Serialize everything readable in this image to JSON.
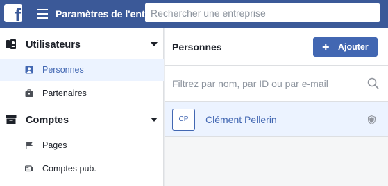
{
  "topbar": {
    "logo_letter": "f",
    "app_title": "Paramètres de l'entreprise",
    "search_placeholder": "Rechercher une entreprise"
  },
  "sidebar": {
    "sections": [
      {
        "label": "Utilisateurs",
        "icon": "users-icon",
        "items": [
          {
            "label": "Personnes",
            "icon": "person-icon",
            "active": true
          },
          {
            "label": "Partenaires",
            "icon": "briefcase-icon",
            "active": false
          }
        ]
      },
      {
        "label": "Comptes",
        "icon": "archive-icon",
        "items": [
          {
            "label": "Pages",
            "icon": "flag-icon",
            "active": false
          },
          {
            "label": "Comptes pub.",
            "icon": "ad-account-icon",
            "active": false
          }
        ]
      }
    ]
  },
  "main": {
    "title": "Personnes",
    "add_button": "Ajouter",
    "filter_placeholder": "Filtrez par nom, par ID ou par e-mail",
    "people": [
      {
        "initials": "CP",
        "name": "Clément Pellerin",
        "badge_icon": "shield-icon"
      }
    ]
  },
  "colors": {
    "brand": "#3b5998",
    "accent": "#4267b2",
    "selected_bg": "#ecf3ff"
  }
}
